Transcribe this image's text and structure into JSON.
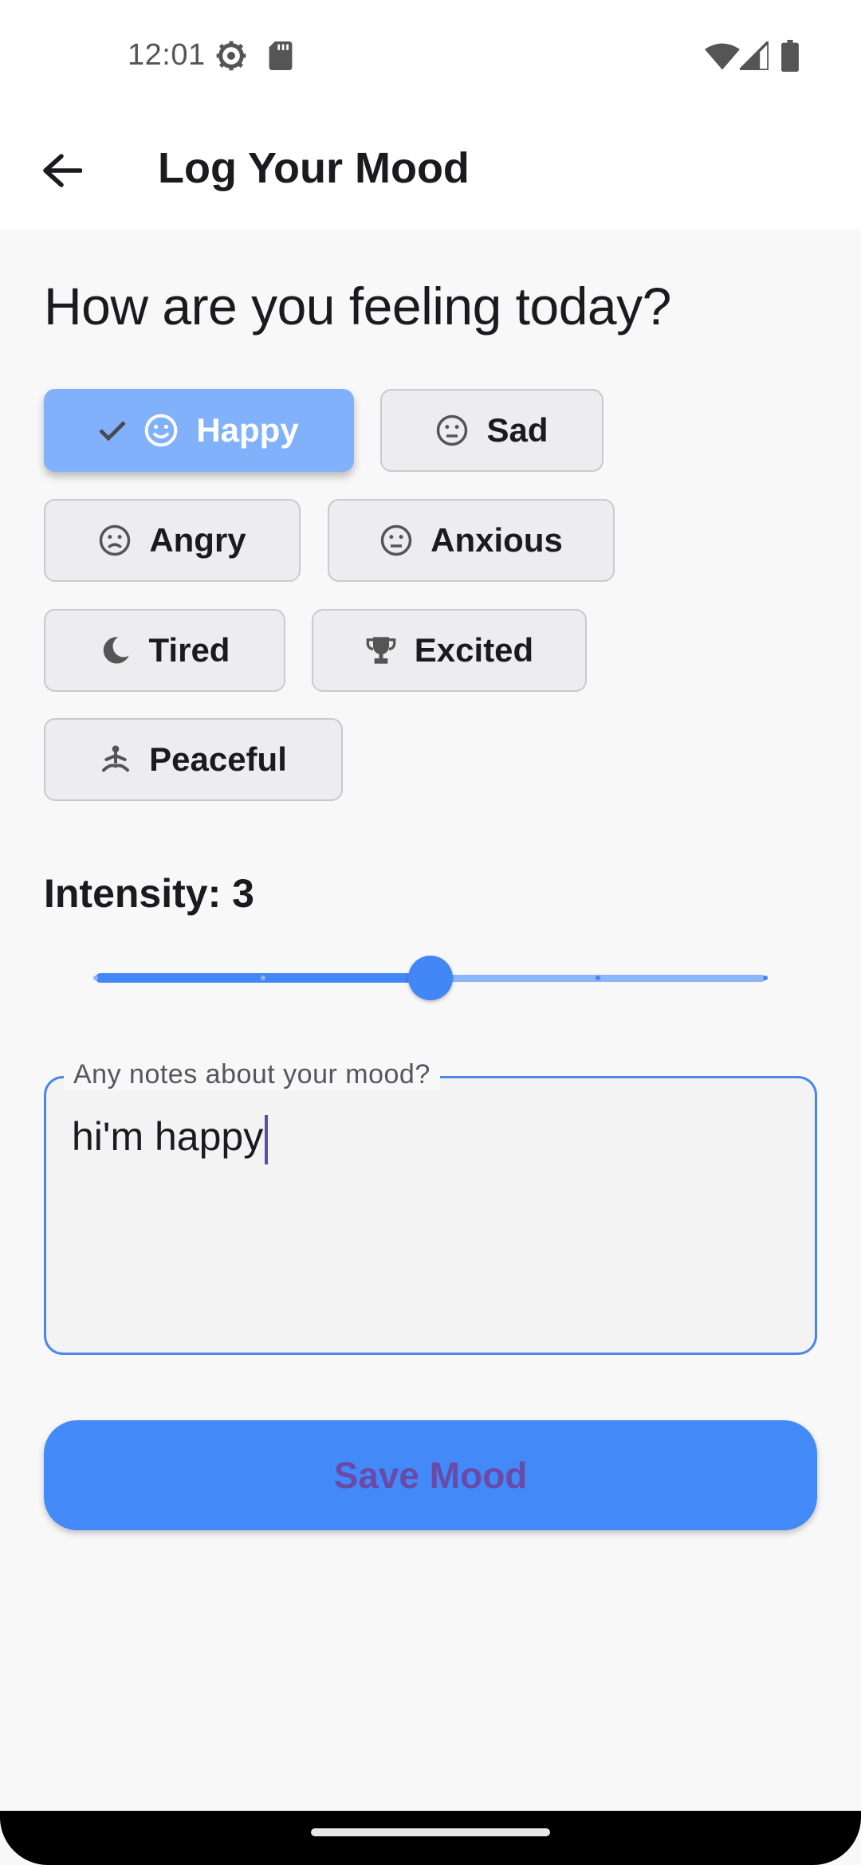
{
  "status_bar": {
    "time": "12:01",
    "icons": [
      "gear-icon",
      "sd-card-icon",
      "wifi-icon",
      "signal-icon",
      "battery-icon"
    ]
  },
  "app_bar": {
    "title": "Log Your Mood",
    "back_icon": "arrow-back-icon"
  },
  "question": "How are you feeling today?",
  "moods": [
    {
      "label": "Happy",
      "icon": "smile-icon",
      "selected": true
    },
    {
      "label": "Sad",
      "icon": "neutral-face-icon",
      "selected": false
    },
    {
      "label": "Angry",
      "icon": "frown-icon",
      "selected": false
    },
    {
      "label": "Anxious",
      "icon": "neutral-face-icon",
      "selected": false
    },
    {
      "label": "Tired",
      "icon": "moon-icon",
      "selected": false
    },
    {
      "label": "Excited",
      "icon": "trophy-icon",
      "selected": false
    },
    {
      "label": "Peaceful",
      "icon": "meditation-icon",
      "selected": false
    }
  ],
  "intensity": {
    "label": "Intensity: 3",
    "value": 3,
    "min": 1,
    "max": 5
  },
  "notes": {
    "label": "Any notes about your mood?",
    "value": "hi'm happy"
  },
  "save_button": {
    "label": "Save Mood"
  },
  "colors": {
    "accent": "#4287f5",
    "selected_chip": "#82b1fb",
    "save_text": "#6a4aa8",
    "field_border": "#4a86ee"
  }
}
